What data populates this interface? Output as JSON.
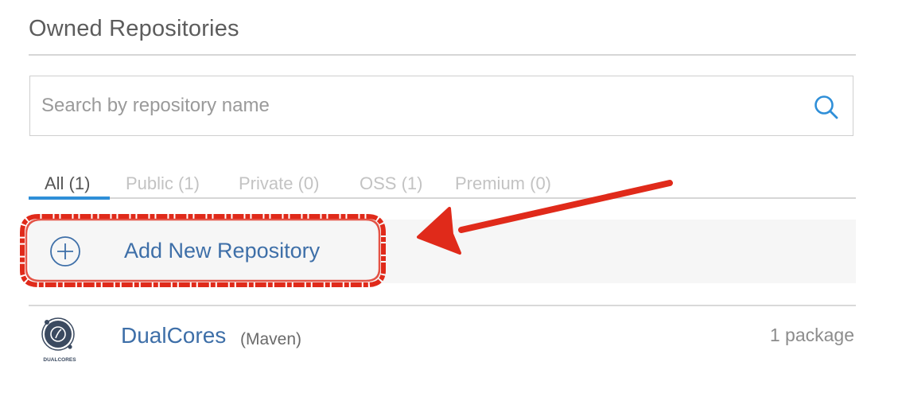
{
  "section": {
    "title": "Owned Repositories"
  },
  "search": {
    "placeholder": "Search by repository name",
    "value": ""
  },
  "tabs": [
    {
      "label": "All (1)",
      "active": true
    },
    {
      "label": "Public (1)",
      "active": false
    },
    {
      "label": "Private (0)",
      "active": false
    },
    {
      "label": "OSS (1)",
      "active": false
    },
    {
      "label": "Premium (0)",
      "active": false
    }
  ],
  "add_repo": {
    "label": "Add New Repository",
    "icon": "plus-circle-icon"
  },
  "repositories": [
    {
      "name": "DualCores",
      "type": "(Maven)",
      "count": "1 package",
      "avatar_text": "DUALCORES"
    }
  ],
  "colors": {
    "accent": "#2f8fd8",
    "link": "#3e6fa8",
    "annotation": "#e02a1a"
  }
}
